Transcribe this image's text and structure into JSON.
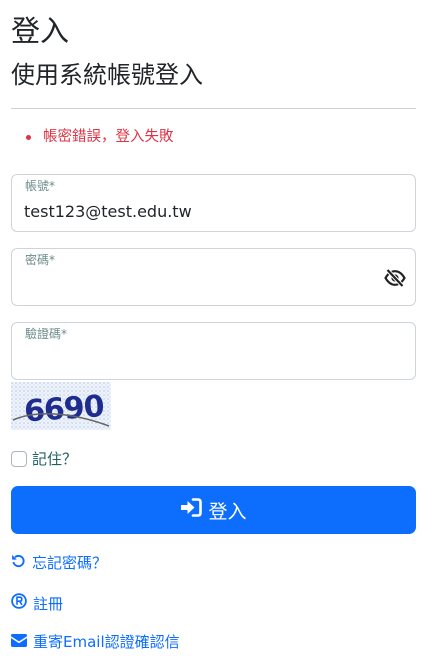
{
  "header": {
    "title": "登入",
    "subtitle": "使用系統帳號登入"
  },
  "errors": [
    "帳密錯誤，登入失敗"
  ],
  "form": {
    "account": {
      "label": "帳號*",
      "value": "test123@test.edu.tw"
    },
    "password": {
      "label": "密碼*",
      "value": ""
    },
    "captcha": {
      "label": "驗證碼*",
      "value": "",
      "image_text": "6690"
    },
    "remember_label": "記住？",
    "submit_label": "登入"
  },
  "links": {
    "forgot_password": "忘記密碼？",
    "register": "註冊",
    "resend_email": "重寄Email認證確認信"
  },
  "icons": {
    "password_toggle": "eye-slash-icon",
    "submit": "sign-in-icon",
    "forgot": "undo-icon",
    "register": "registered-icon",
    "resend": "envelope-icon"
  },
  "colors": {
    "primary": "#0d6efd",
    "error": "#dc3545",
    "border": "#ced4da"
  }
}
